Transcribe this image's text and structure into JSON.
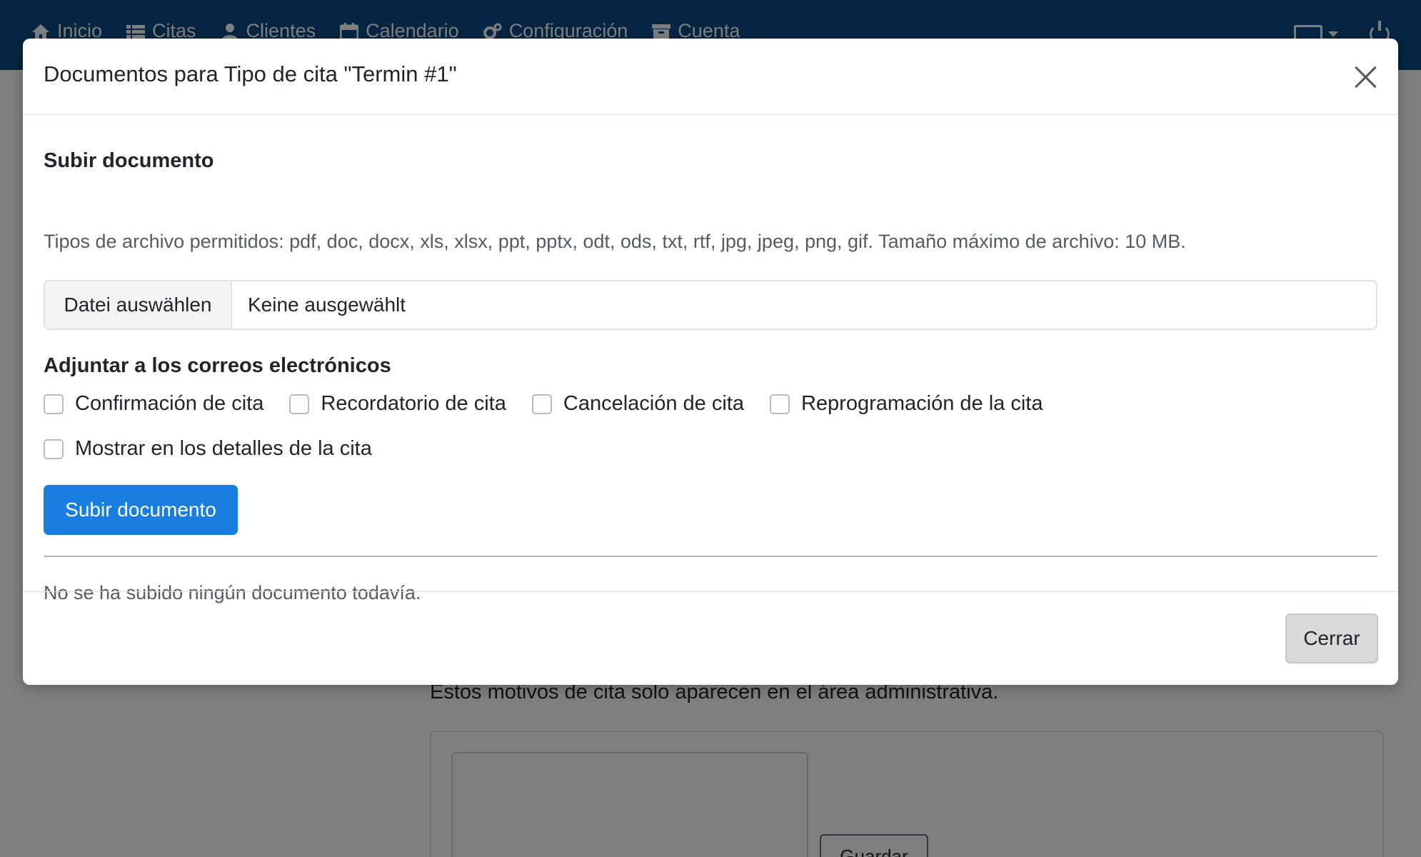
{
  "navbar": {
    "items": [
      {
        "label": "Inicio",
        "icon": "home-icon"
      },
      {
        "label": "Citas",
        "icon": "list-icon"
      },
      {
        "label": "Clientes",
        "icon": "user-icon"
      },
      {
        "label": "Calendario",
        "icon": "calendar-icon"
      },
      {
        "label": "Configuración",
        "icon": "gears-icon"
      },
      {
        "label": "Cuenta",
        "icon": "archive-icon"
      }
    ],
    "right_icons": [
      "language-icon",
      "power-icon"
    ]
  },
  "background": {
    "info_text": "Estos motivos de cita solo aparecen en el área administrativa.",
    "save_label": "Guardar"
  },
  "modal": {
    "title": "Documentos para Tipo de cita \"Termin #1\"",
    "upload_heading": "Subir documento",
    "allowed_types_text": "Tipos de archivo permitidos: pdf, doc, docx, xls, xlsx, ppt, pptx, odt, ods, txt, rtf, jpg, jpeg, png, gif. Tamaño máximo de archivo: 10 MB.",
    "file_input": {
      "button_label": "Datei auswählen",
      "value": "Keine ausgewählt"
    },
    "attach_heading": "Adjuntar a los correos electrónicos",
    "checkboxes": [
      {
        "label": "Confirmación de cita",
        "checked": false
      },
      {
        "label": "Recordatorio de cita",
        "checked": false
      },
      {
        "label": "Cancelación de cita",
        "checked": false
      },
      {
        "label": "Reprogramación de la cita",
        "checked": false
      },
      {
        "label": "Mostrar en los detalles de la cita",
        "checked": false
      }
    ],
    "upload_button_label": "Subir documento",
    "empty_message": "No se ha subido ningún documento todavía.",
    "close_button_label": "Cerrar"
  },
  "colors": {
    "navbar": "#0b4a86",
    "primary": "#1a7ee0",
    "secondary": "#d8d9db"
  }
}
